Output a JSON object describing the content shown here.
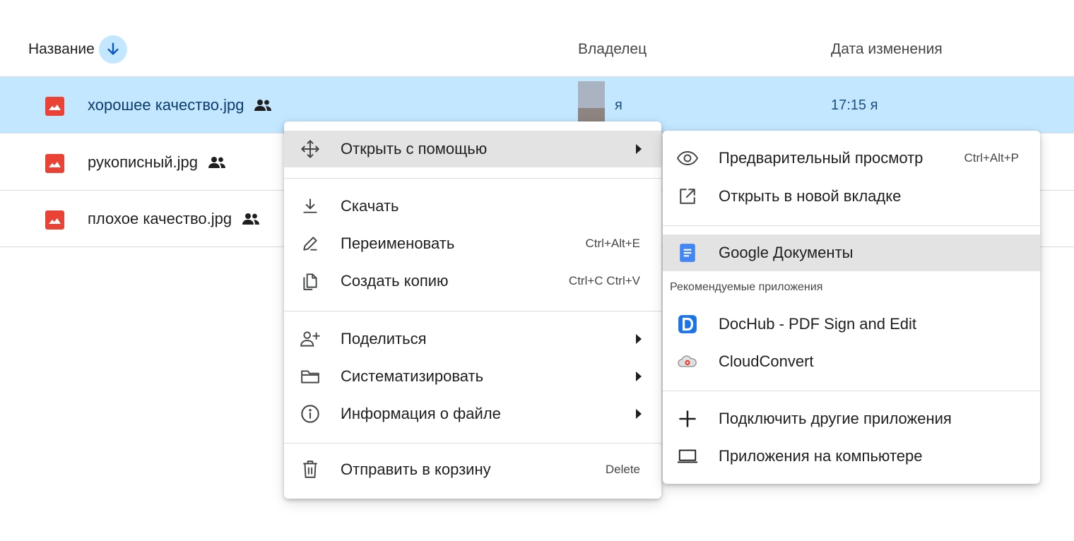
{
  "header": {
    "name_label": "Название",
    "owner_label": "Владелец",
    "date_label": "Дата изменения"
  },
  "files": [
    {
      "name": "хорошее качество.jpg",
      "owner": "я",
      "modified": "17:15 я",
      "selected": true
    },
    {
      "name": "рукописный.jpg",
      "selected": false
    },
    {
      "name": "плохое качество.jpg",
      "selected": false
    }
  ],
  "context_menu": {
    "open_with": "Открыть с помощью",
    "download": "Скачать",
    "rename": "Переименовать",
    "rename_shortcut": "Ctrl+Alt+E",
    "make_copy": "Создать копию",
    "make_copy_shortcut": "Ctrl+C Ctrl+V",
    "share": "Поделиться",
    "organize": "Систематизировать",
    "file_info": "Информация о файле",
    "trash": "Отправить в корзину",
    "trash_shortcut": "Delete"
  },
  "submenu": {
    "preview": "Предварительный просмотр",
    "preview_shortcut": "Ctrl+Alt+P",
    "new_tab": "Открыть в новой вкладке",
    "google_docs": "Google Документы",
    "suggested_label": "Рекомендуемые приложения",
    "dochub": "DocHub - PDF Sign and Edit",
    "cloudconvert": "CloudConvert",
    "connect_more": "Подключить другие приложения",
    "desktop_apps": "Приложения на компьютере"
  },
  "colors": {
    "selected_row": "#c2e7ff",
    "image_icon": "#ea4335",
    "docs_blue": "#4285f4",
    "dochub_blue": "#1a73e8",
    "hover_gray": "#e3e3e3"
  },
  "icons": {
    "sort": "arrow-down-icon",
    "file": "image-icon",
    "shared": "people-icon"
  }
}
